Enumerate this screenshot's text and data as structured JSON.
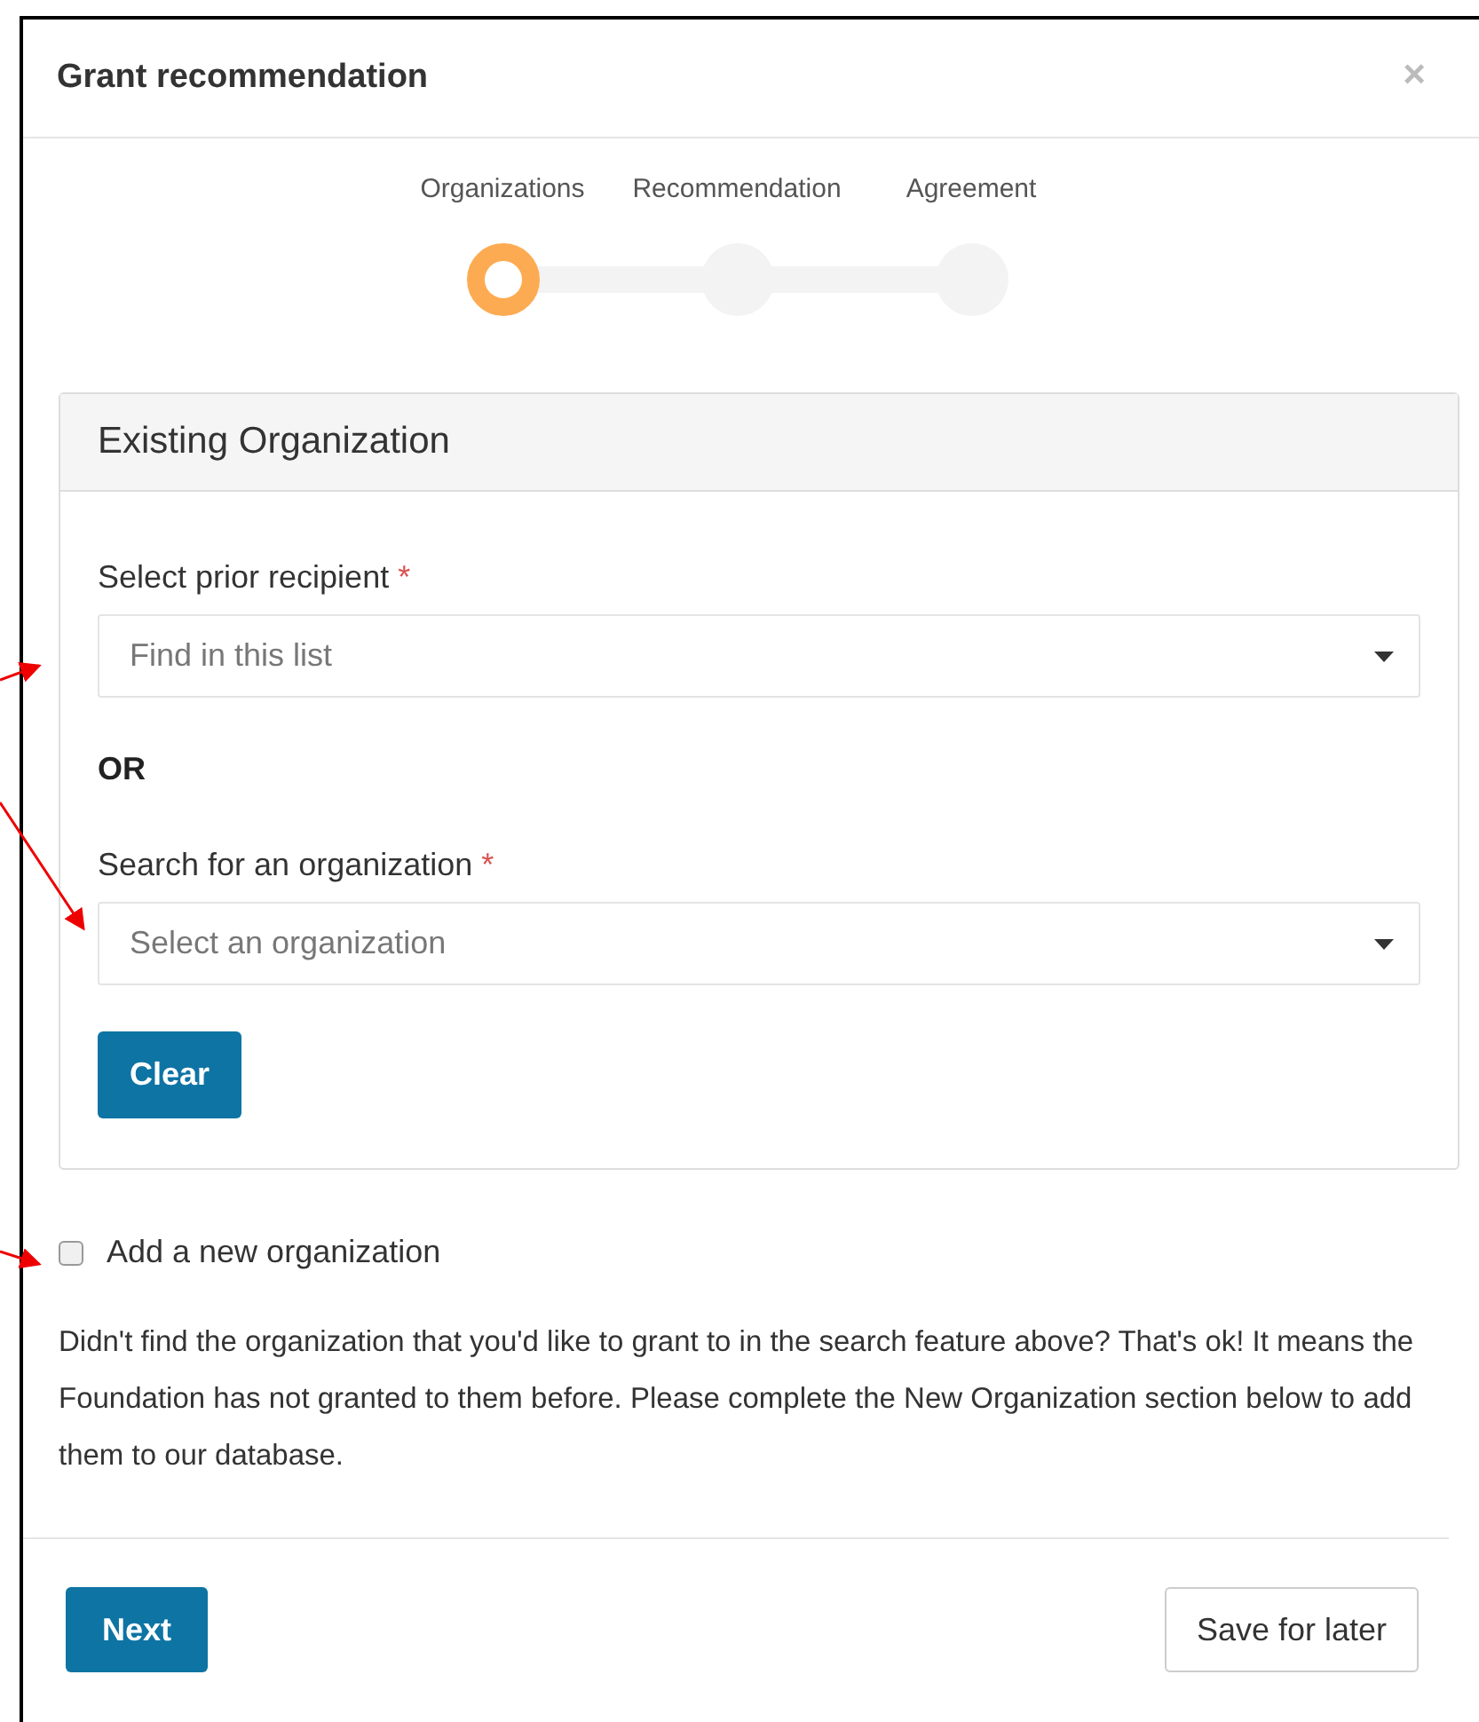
{
  "dialog": {
    "title": "Grant recommendation",
    "close": "×"
  },
  "steps": [
    {
      "label": "Organizations",
      "selected": true
    },
    {
      "label": "Recommendation",
      "selected": false
    },
    {
      "label": "Agreement",
      "selected": false
    }
  ],
  "panel": {
    "title": "Existing Organization",
    "fields": [
      {
        "label": "Select prior recipient",
        "required_mark": "*",
        "placeholder": "Find in this list"
      },
      {
        "label": "Search for an organization",
        "required_mark": "*",
        "placeholder": "Select an organization"
      }
    ],
    "separator": "OR",
    "clear_button": "Clear"
  },
  "new_organization": {
    "label": "Add a new organization",
    "checked": false
  },
  "help_text": "Didn't find the organization that you'd like to grant to in the search feature above? That's ok! It means the Foundation has not granted to them before. Please complete the New Organization section below to add them to our database.",
  "footer": {
    "next_button": "Next",
    "save_button": "Save for later"
  }
}
